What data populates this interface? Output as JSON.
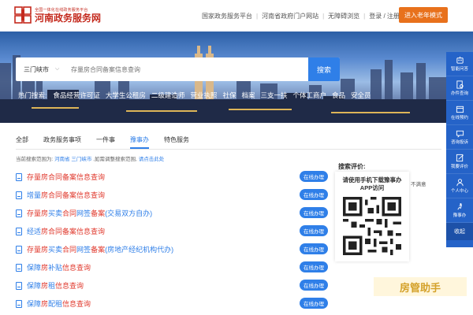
{
  "header": {
    "logo_sub": "全国一体化在线政务服务平台",
    "logo_main": "河南政务服务网",
    "links": [
      "国家政务服务平台",
      "河南省政府门户网站",
      "无障碍浏览",
      "登录 / 注册"
    ],
    "elder_mode": "进入老年模式"
  },
  "search": {
    "region": "三门峡市",
    "placeholder": "存量房合同备案信息查询",
    "button": "搜索"
  },
  "hot": {
    "label": "热门搜索:",
    "items": [
      "食品经营许可证",
      "大学生公租房",
      "二级建造师",
      "营业执照",
      "社保",
      "档案",
      "三支一扶",
      "个体工商户",
      "食品",
      "安全员"
    ]
  },
  "sidebar": {
    "items": [
      "智能问答",
      "办件查询",
      "在线预约",
      "咨询投诉",
      "我要评价",
      "个人中心",
      "豫事办"
    ],
    "collapse": "收起"
  },
  "tabs": [
    "全部",
    "政务服务事项",
    "一件事",
    "豫事办",
    "特色服务"
  ],
  "active_tab": "豫事办",
  "range": {
    "prefix": "当前搜索范围为:",
    "region": "河南省 三门峡市",
    "middle": ",如需调整搜索范围,",
    "link": "请点击此处"
  },
  "results": [
    {
      "title": "存量房合同备案信息查询",
      "button": "在线办理"
    },
    {
      "title": "增量房合同备案信息查询",
      "button": "在线办理"
    },
    {
      "title": "存量房买卖合同网签备案(交易双方自办)",
      "button": "在线办理"
    },
    {
      "title": "经适房合同备案信息查询",
      "button": "在线办理"
    },
    {
      "title": "存量房买卖合同网签备案(房地产经纪机构代办)",
      "button": "在线办理"
    },
    {
      "title": "保障房补贴信息查询",
      "button": "在线办理"
    },
    {
      "title": "保障房房租信息查询",
      "button": "在线办理"
    },
    {
      "title": "保障房配租信息查询",
      "button": "在线办理"
    }
  ],
  "eval": {
    "title": "搜索评价:",
    "message": "请使用手机下载豫事办APP访问",
    "unsatisfied": "不满意"
  },
  "watermark": "房管助手",
  "colors": {
    "brand_red": "#c4291d",
    "primary_blue": "#2f7fe8",
    "elder_orange": "#e8711c",
    "sidebar_blue": "#2563c8"
  }
}
